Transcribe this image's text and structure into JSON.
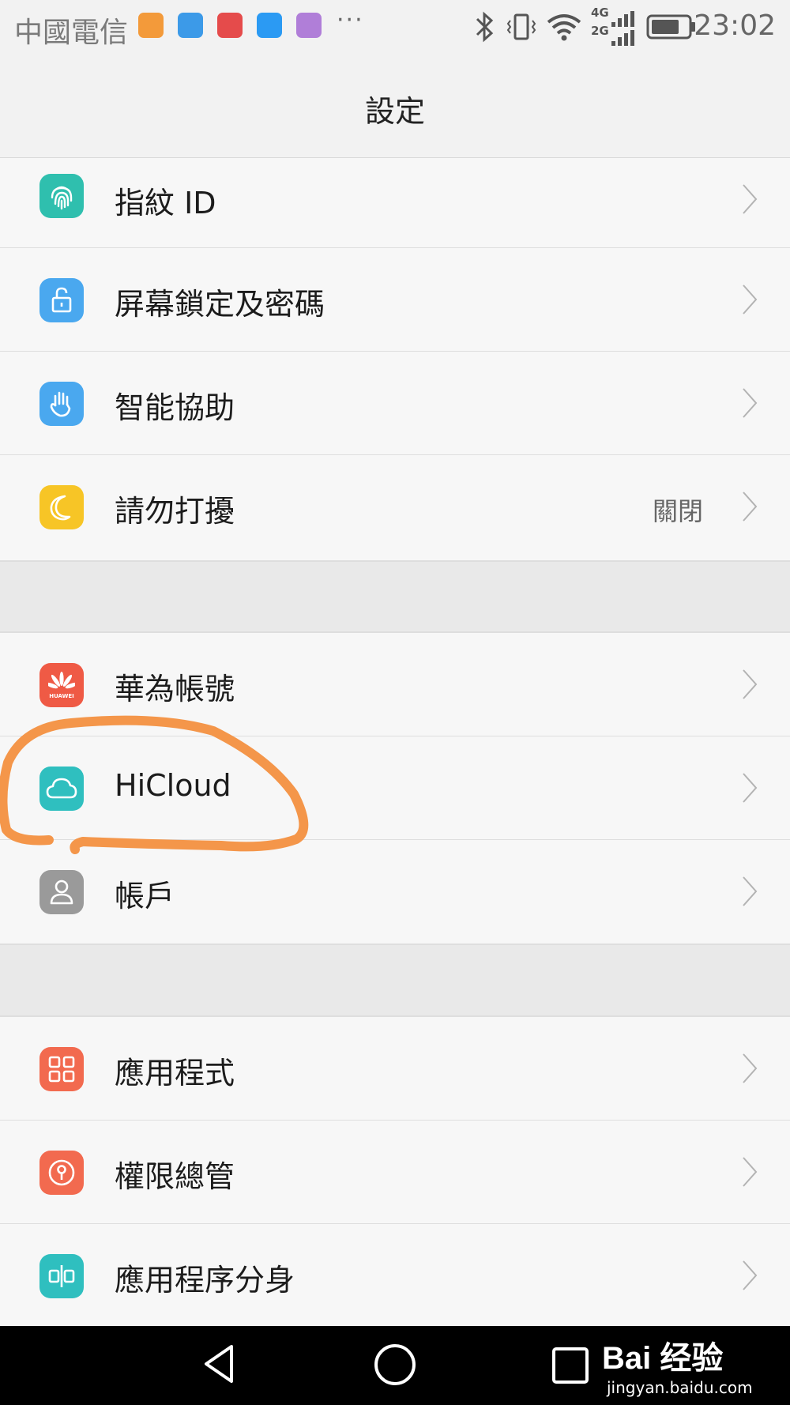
{
  "status_bar": {
    "carrier": "中國電信",
    "notification_icons": [
      "uc-browser-icon",
      "clean-app-icon",
      "money-locker-icon",
      "messages-icon",
      "gallery-icon"
    ],
    "more": "···",
    "network_top": "4G",
    "network_bottom": "2G",
    "time": "23:02"
  },
  "header": {
    "title": "設定"
  },
  "groups": [
    {
      "items": [
        {
          "label": "指紋 ID",
          "icon": "fingerprint-icon",
          "color": "#2fbfae"
        },
        {
          "label": "屏幕鎖定及密碼",
          "icon": "lock-icon",
          "color": "#4aa8ef"
        },
        {
          "label": "智能協助",
          "icon": "hand-icon",
          "color": "#4aa8ef"
        },
        {
          "label": "請勿打擾",
          "icon": "moon-icon",
          "color": "#f7c526",
          "value": "關閉"
        }
      ]
    },
    {
      "items": [
        {
          "label": "華為帳號",
          "icon": "huawei-logo-icon",
          "color": "#ef5a45",
          "logo_text": "HUAWEI"
        },
        {
          "label": "HiCloud",
          "icon": "cloud-icon",
          "color": "#2fbfbf"
        },
        {
          "label": "帳戶",
          "icon": "user-icon",
          "color": "#9a9a9a"
        }
      ]
    },
    {
      "items": [
        {
          "label": "應用程式",
          "icon": "apps-grid-icon",
          "color": "#f26a4f"
        },
        {
          "label": "權限總管",
          "icon": "permission-icon",
          "color": "#f26a4f"
        },
        {
          "label": "應用程序分身",
          "icon": "app-twin-icon",
          "color": "#2fbfbf"
        }
      ]
    }
  ],
  "watermark": {
    "brand": "Bai 经验",
    "url": "jingyan.baidu.com"
  },
  "annotation_color": "#f4964a"
}
